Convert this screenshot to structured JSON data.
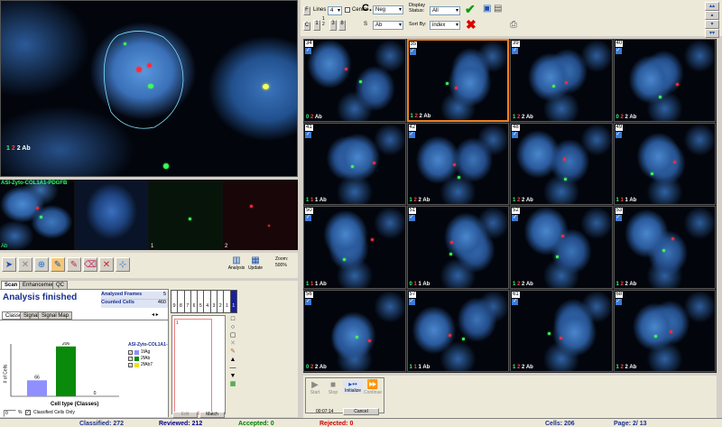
{
  "main_view": {
    "overlay_label": "2 Ab",
    "count_green": "1",
    "count_red": "2",
    "zoom_label": "Zoom:",
    "zoom_value": "500%"
  },
  "channels": {
    "title": "ASI-Zyto-COL1A1-PDGFB",
    "labels": [
      "Ab",
      "1",
      "2"
    ]
  },
  "toolbar": {
    "analysis_label": "Analysis",
    "update_label": "Update"
  },
  "analysis": {
    "tabs": [
      "Scan",
      "Enhancement",
      "QC"
    ],
    "status": "Analysis finished",
    "analyzed_frames_label": "Analyzed Frames",
    "analyzed_frames": "5",
    "counted_cells_label": "Counted Cells",
    "counted_cells": "460",
    "subtabs": [
      "Classes",
      "Signals",
      "Signal Map"
    ],
    "class_numbers": [
      "9",
      "8",
      "7",
      "6",
      "5",
      "4",
      "3",
      "2",
      "1"
    ],
    "class_selected": "1",
    "list_item": "1",
    "edit_label": "Edit",
    "match_label": "Match",
    "class_input": "0",
    "classified_only_label": "Classified Cells Only"
  },
  "chart_data": {
    "type": "bar",
    "categories": [
      "1fAg",
      "2fAb",
      "2fAb7"
    ],
    "values": [
      66,
      206,
      0
    ],
    "ylabel": "# of Cells",
    "xlabel": "Cell type (Classes)",
    "legend_title": "ASI-Zyto-COL1A1-",
    "colors": [
      "#8f8fff",
      "#0a8a0a",
      "#f0e020"
    ]
  },
  "right_toolbar": {
    "lines_label": "Lines",
    "lines_value": "4",
    "center_label": "Center",
    "c_label": "C.",
    "neg_value": "Neg",
    "s_label": "S",
    "ab_value": "Ab",
    "display_status_label": "Display Status:",
    "display_status_value": "All",
    "sort_by_label": "Sort By:",
    "sort_by_value": "index",
    "f_label": "F",
    "c2_label": "C",
    "one": "1",
    "two": "2",
    "three": "3",
    "eight": "8",
    "ok_icon": "check-icon",
    "reject_icon": "x-icon"
  },
  "thumbnails": [
    {
      "num": "34",
      "g": "0",
      "r": "2",
      "label": "Ab",
      "selected": false
    },
    {
      "num": "35",
      "g": "1",
      "r": "2",
      "label": "2 Ab",
      "selected": true
    },
    {
      "num": "39",
      "g": "1",
      "r": "2",
      "label": "2 Ab",
      "selected": false
    },
    {
      "num": "40",
      "g": "0",
      "r": "2",
      "label": "2 Ab",
      "selected": false
    },
    {
      "num": "41",
      "g": "1",
      "r": "1",
      "label": "1 Ab",
      "selected": false
    },
    {
      "num": "42",
      "g": "1",
      "r": "2",
      "label": "2 Ab",
      "selected": false
    },
    {
      "num": "48",
      "g": "1",
      "r": "2",
      "label": "2 Ab",
      "selected": false
    },
    {
      "num": "49",
      "g": "1",
      "r": "1",
      "label": "1 Ab",
      "selected": false
    },
    {
      "num": "50",
      "g": "1",
      "r": "1",
      "label": "1 Ab",
      "selected": false
    },
    {
      "num": "51",
      "g": "0",
      "r": "1",
      "label": "1 Ab",
      "selected": false
    },
    {
      "num": "52",
      "g": "1",
      "r": "2",
      "label": "2 Ab",
      "selected": false
    },
    {
      "num": "53",
      "g": "1",
      "r": "2",
      "label": "2 Ab",
      "selected": false
    },
    {
      "num": "56",
      "g": "0",
      "r": "2",
      "label": "2 Ab",
      "selected": false
    },
    {
      "num": "57",
      "g": "1",
      "r": "1",
      "label": "1 Ab",
      "selected": false
    },
    {
      "num": "61",
      "g": "1",
      "r": "2",
      "label": "2 Ab",
      "selected": false
    },
    {
      "num": "68",
      "g": "1",
      "r": "2",
      "label": "2 Ab",
      "selected": false
    }
  ],
  "playback": {
    "start": "Start",
    "stop": "Stop",
    "initialize": "Initialize",
    "continue": "Continue",
    "time": "00:07:14",
    "cancel": "Cancel"
  },
  "status": {
    "classified": "Classified: 272",
    "reviewed": "Reviewed: 212",
    "accepted": "Accepted: 0",
    "rejected": "Rejected: 0",
    "cells": "Cells: 206",
    "page": "Page:   2/ 13",
    "accepted_color": "#008000",
    "rejected_color": "#d00000",
    "reviewed_color": "#00008b"
  }
}
